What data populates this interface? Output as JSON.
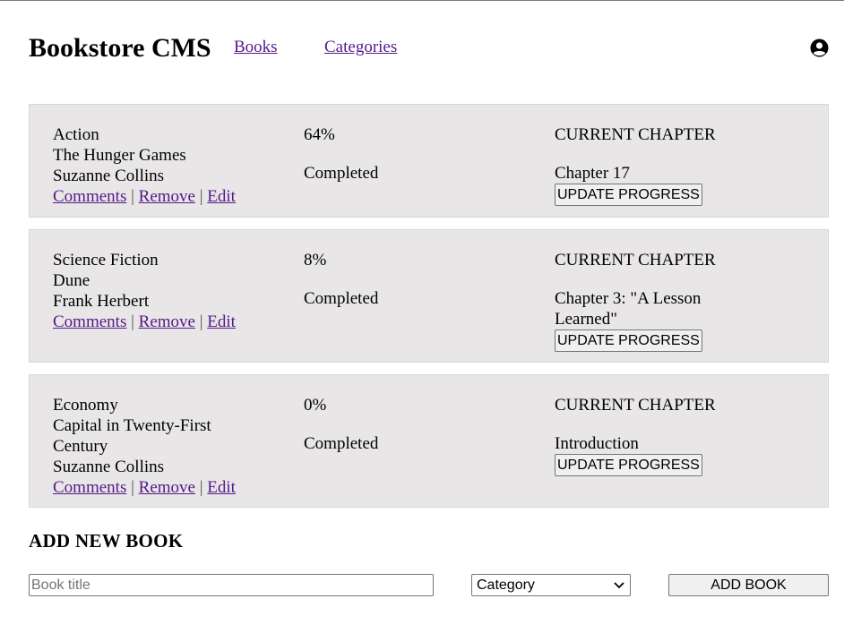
{
  "header": {
    "brand": "Bookstore CMS",
    "nav": [
      {
        "label": "Books"
      },
      {
        "label": "Categories"
      }
    ],
    "user_icon": "user-circle-icon"
  },
  "books": [
    {
      "category": "Action",
      "title": "The Hunger Games",
      "author": "Suzanne Collins",
      "progress_percent": "64%",
      "progress_label": "Completed",
      "chapter_heading": "CURRENT CHAPTER",
      "chapter": "Chapter 17",
      "update_label": "UPDATE PROGRESS",
      "actions": {
        "comments": "Comments",
        "remove": "Remove",
        "edit": "Edit",
        "separator": "|"
      }
    },
    {
      "category": "Science Fiction",
      "title": "Dune",
      "author": "Frank Herbert",
      "progress_percent": "8%",
      "progress_label": "Completed",
      "chapter_heading": "CURRENT CHAPTER",
      "chapter": "Chapter 3: \"A Lesson Learned\"",
      "update_label": "UPDATE PROGRESS",
      "actions": {
        "comments": "Comments",
        "remove": "Remove",
        "edit": "Edit",
        "separator": "|"
      }
    },
    {
      "category": "Economy",
      "title": "Capital in Twenty-First Century",
      "author": "Suzanne Collins",
      "progress_percent": "0%",
      "progress_label": "Completed",
      "chapter_heading": "CURRENT CHAPTER",
      "chapter": "Introduction",
      "update_label": "UPDATE PROGRESS",
      "actions": {
        "comments": "Comments",
        "remove": "Remove",
        "edit": "Edit",
        "separator": "|"
      }
    }
  ],
  "add_form": {
    "heading": "ADD NEW BOOK",
    "title_placeholder": "Book title",
    "category_selected": "Category",
    "submit_label": "ADD BOOK"
  },
  "colors": {
    "card_background": "#e8e6e6",
    "link": "#551a8b"
  }
}
